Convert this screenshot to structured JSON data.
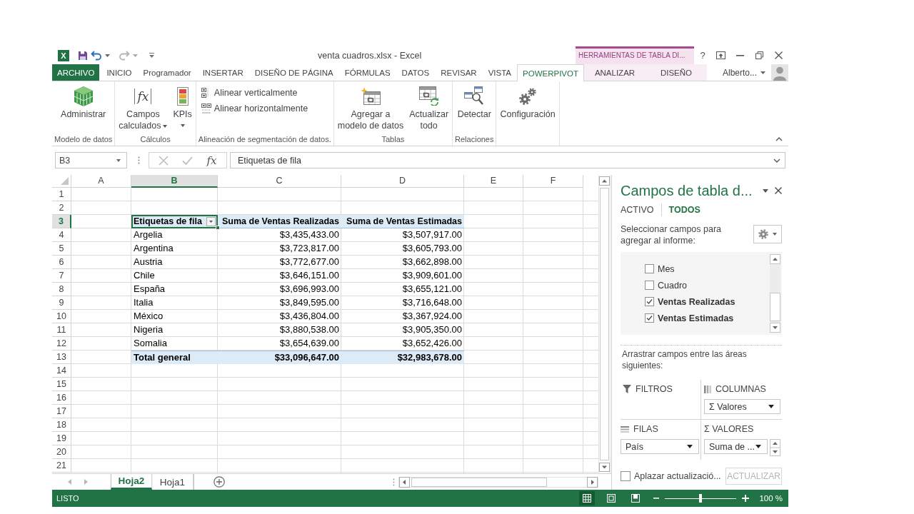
{
  "window": {
    "logo": "X",
    "title": "venta cuadros.xlsx - Excel",
    "contextual_group": "HERRAMIENTAS DE TABLA DI...",
    "help": "?"
  },
  "ribbon_tabs": [
    {
      "label": "ARCHIVO",
      "kind": "file",
      "selected": false
    },
    {
      "label": "INICIO",
      "kind": "main",
      "selected": false
    },
    {
      "label": "Programador",
      "kind": "main",
      "selected": false
    },
    {
      "label": "INSERTAR",
      "kind": "main",
      "selected": false
    },
    {
      "label": "DISEÑO DE PÁGINA",
      "kind": "main",
      "selected": false
    },
    {
      "label": "FÓRMULAS",
      "kind": "main",
      "selected": false
    },
    {
      "label": "DATOS",
      "kind": "main",
      "selected": false
    },
    {
      "label": "REVISAR",
      "kind": "main",
      "selected": false
    },
    {
      "label": "VISTA",
      "kind": "main",
      "selected": false
    },
    {
      "label": "POWERPIVOT",
      "kind": "main",
      "selected": true
    },
    {
      "label": "ANALIZAR",
      "kind": "contextual",
      "selected": false
    },
    {
      "label": "DISEÑO",
      "kind": "contextual",
      "selected": false
    }
  ],
  "account": {
    "name": "Alberto..."
  },
  "ribbon_groups": [
    {
      "label": "Modelo de datos",
      "buttons": [
        {
          "label": "Administrar",
          "kind": "large",
          "dropdown": false
        }
      ]
    },
    {
      "label": "Cálculos",
      "buttons": [
        {
          "label": "Campos\ncalculados",
          "kind": "large",
          "dropdown": true,
          "glyph": "fx"
        },
        {
          "label": "KPIs",
          "kind": "menu",
          "dropdown": true
        }
      ]
    },
    {
      "label": "Alineación de segmentación de datos.",
      "buttons": [
        {
          "label": "Alinear verticalmente",
          "kind": "small",
          "dropdown": false
        },
        {
          "label": "Alinear horizontalmente",
          "kind": "small",
          "dropdown": false
        }
      ]
    },
    {
      "label": "Tablas",
      "buttons": [
        {
          "label": "Agregar a\nmodelo de datos",
          "kind": "large",
          "dropdown": false
        },
        {
          "label": "Actualizar\ntodo",
          "kind": "large",
          "dropdown": false
        }
      ]
    },
    {
      "label": "Relaciones",
      "buttons": [
        {
          "label": "Detectar",
          "kind": "large",
          "dropdown": false
        }
      ]
    },
    {
      "buttons": [
        {
          "label": "Configuración",
          "kind": "large",
          "dropdown": false
        }
      ]
    }
  ],
  "formula_bar": {
    "name_box": "B3",
    "function_glyph": "fx",
    "formula": "Etiquetas de fila"
  },
  "sheet": {
    "columns": [
      {
        "label": "A",
        "selected": false
      },
      {
        "label": "B",
        "selected": true
      },
      {
        "label": "C",
        "selected": false
      },
      {
        "label": "D",
        "selected": false
      },
      {
        "label": "E",
        "selected": false
      },
      {
        "label": "F",
        "selected": false
      }
    ],
    "rows": [
      {
        "number": "1",
        "selected": false
      },
      {
        "number": "2",
        "selected": false
      },
      {
        "number": "3",
        "selected": true,
        "kind": "pivot_header",
        "cells": [
          "Etiquetas de fila",
          "Suma de Ventas Realizadas",
          "Suma de Ventas Estimadas"
        ]
      },
      {
        "number": "4",
        "selected": false,
        "kind": "pivot_row",
        "cells": [
          "Argelia",
          "$3,435,433.00",
          "$3,507,917.00"
        ]
      },
      {
        "number": "5",
        "selected": false,
        "kind": "pivot_row",
        "cells": [
          "Argentina",
          "$3,723,817.00",
          "$3,605,793.00"
        ]
      },
      {
        "number": "6",
        "selected": false,
        "kind": "pivot_row",
        "cells": [
          "Austria",
          "$3,772,677.00",
          "$3,662,898.00"
        ]
      },
      {
        "number": "7",
        "selected": false,
        "kind": "pivot_row",
        "cells": [
          "Chile",
          "$3,646,151.00",
          "$3,909,601.00"
        ]
      },
      {
        "number": "8",
        "selected": false,
        "kind": "pivot_row",
        "cells": [
          "España",
          "$3,696,993.00",
          "$3,655,121.00"
        ]
      },
      {
        "number": "9",
        "selected": false,
        "kind": "pivot_row",
        "cells": [
          "Italia",
          "$3,849,595.00",
          "$3,716,648.00"
        ]
      },
      {
        "number": "10",
        "selected": false,
        "kind": "pivot_row",
        "cells": [
          "México",
          "$3,436,804.00",
          "$3,367,924.00"
        ]
      },
      {
        "number": "11",
        "selected": false,
        "kind": "pivot_row",
        "cells": [
          "Nigeria",
          "$3,880,538.00",
          "$3,905,350.00"
        ]
      },
      {
        "number": "12",
        "selected": false,
        "kind": "pivot_row",
        "cells": [
          "Somalia",
          "$3,654,639.00",
          "$3,652,426.00"
        ]
      },
      {
        "number": "13",
        "selected": false,
        "kind": "pivot_total",
        "cells": [
          "Total general",
          "$33,096,647.00",
          "$32,983,678.00"
        ]
      },
      {
        "number": "14",
        "selected": false
      },
      {
        "number": "15",
        "selected": false
      },
      {
        "number": "16",
        "selected": false
      },
      {
        "number": "17",
        "selected": false
      },
      {
        "number": "18",
        "selected": false
      },
      {
        "number": "19",
        "selected": false
      },
      {
        "number": "20",
        "selected": false
      },
      {
        "number": "21",
        "selected": false
      }
    ]
  },
  "sheet_tabs": [
    {
      "label": "Hoja2",
      "selected": true
    },
    {
      "label": "Hoja1",
      "selected": false
    }
  ],
  "field_panel": {
    "title": "Campos de tabla d...",
    "tabs": [
      {
        "label": "ACTIVO",
        "selected": false
      },
      {
        "label": "TODOS",
        "selected": true
      }
    ],
    "instruction": "Seleccionar campos para agregar al informe:",
    "fields": [
      {
        "label": "Mes",
        "checked": false
      },
      {
        "label": "Cuadro",
        "checked": false
      },
      {
        "label": "Ventas Realizadas",
        "checked": true
      },
      {
        "label": "Ventas Estimadas",
        "checked": true
      }
    ],
    "drag_hint": "Arrastrar campos entre las áreas siguientes:",
    "areas": [
      {
        "kind": "filters",
        "label": "FILTROS"
      },
      {
        "kind": "columns",
        "label": "COLUMNAS",
        "items": [
          "Σ Valores"
        ]
      },
      {
        "kind": "rows",
        "label": "FILAS",
        "items": [
          "País"
        ]
      },
      {
        "kind": "values",
        "label": "Σ VALORES",
        "items": [
          "Suma de ..."
        ]
      }
    ],
    "defer": {
      "label": "Aplazar actualizació...",
      "checked": false
    },
    "update_button": {
      "label": "ACTUALIZAR",
      "disabled": true
    }
  },
  "status_bar": {
    "text": "LISTO",
    "views": [
      {
        "selected": true
      },
      {
        "selected": false
      },
      {
        "selected": false
      }
    ],
    "zoom": {
      "level": 0.5,
      "reading": "100 %"
    }
  }
}
